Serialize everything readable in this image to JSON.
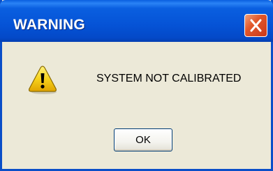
{
  "dialog": {
    "title": "WARNING",
    "message": "SYSTEM NOT CALIBRATED",
    "icon": "warning-icon",
    "close_icon": "close-icon",
    "ok_label": "OK"
  },
  "colors": {
    "titlebar": "#0553d6",
    "close_button": "#e2572a",
    "body_background": "#ece9d8",
    "warning_icon": "#f7d21c"
  }
}
